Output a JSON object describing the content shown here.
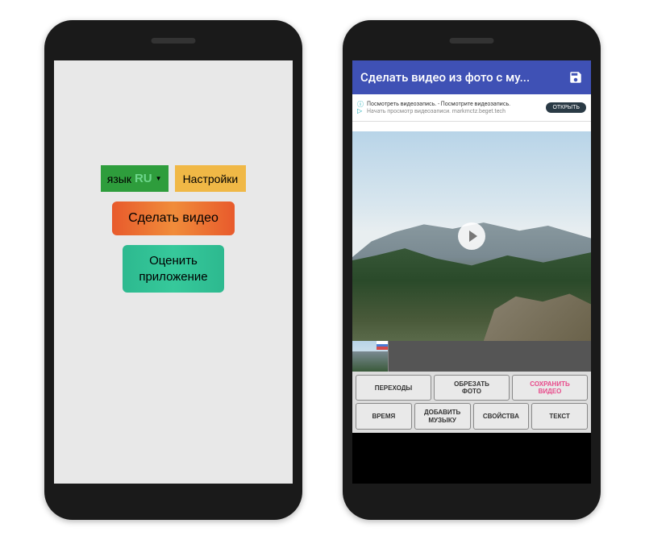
{
  "phone1": {
    "language": {
      "label": "язык",
      "value": "RU"
    },
    "settings": "Настройки",
    "make_video": "Сделать видео",
    "rate_app_line1": "Оценить",
    "rate_app_line2": "приложение"
  },
  "phone2": {
    "header_title": "Сделать видео из фото с му...",
    "ad": {
      "line1": "Посмотреть видеозапись. - Посмотрите видеозапись.",
      "line2": "Начать просмотр видеозаписи. markmctz.beget.tech",
      "cta": "ОТКРЫТЬ"
    },
    "toolbar": {
      "transitions": "ПЕРЕХОДЫ",
      "crop_photo": "ОБРЕЗАТЬ\nФОТО",
      "save_video": "СОХРАНИТЬ\nВИДЕО",
      "time": "ВРЕМЯ",
      "add_music": "ДОБАВИТЬ\nМУЗЫКУ",
      "properties": "СВОЙСТВА",
      "text": "ТЕКСТ"
    }
  }
}
